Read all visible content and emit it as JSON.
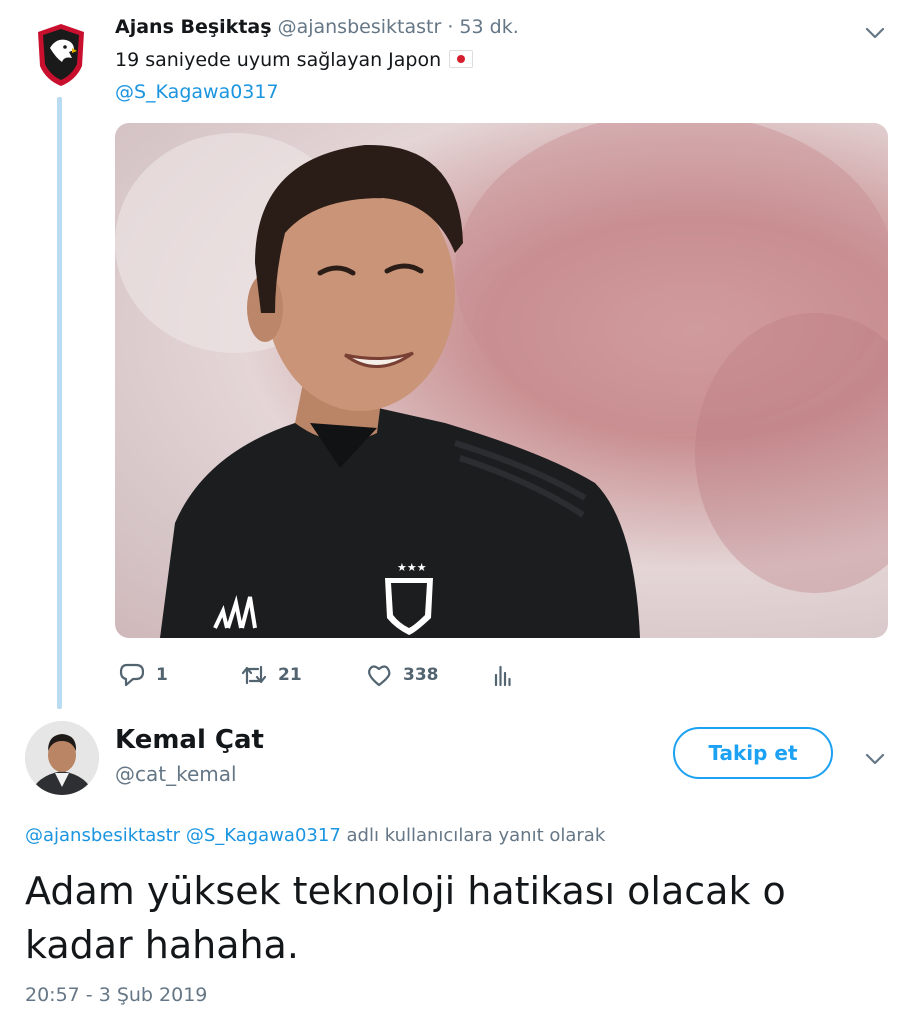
{
  "parent_tweet": {
    "author_name": "Ajans Beşiktaş",
    "author_handle": "@ajansbesiktastr",
    "separator": "·",
    "time": "53 dk.",
    "text": "19 saniyede uyum sağlayan Japon",
    "flag_emoji": "japan-flag",
    "mention": "@S_Kagawa0317",
    "photo_alt": "Player photo",
    "replies": "1",
    "retweets": "21",
    "likes": "338"
  },
  "main_tweet": {
    "author_name": "Kemal Çat",
    "author_handle": "@cat_kemal",
    "follow_label": "Takip et",
    "reply_mention_1": "@ajansbesiktastr",
    "reply_mention_2": "@S_Kagawa0317",
    "reply_suffix": "adlı kullanıcılara yanıt olarak",
    "text": "Adam yüksek teknoloji hatikası olacak o kadar hahaha.",
    "timestamp": "20:57 - 3 Şub 2019"
  },
  "colors": {
    "accent": "#1da1f2",
    "link": "#1b95e0",
    "muted": "#657786",
    "thread_line": "#b9dcf2"
  },
  "icons": [
    "club-logo-icon",
    "chevron-down-icon",
    "reply-icon",
    "retweet-icon",
    "like-icon",
    "analytics-icon"
  ]
}
